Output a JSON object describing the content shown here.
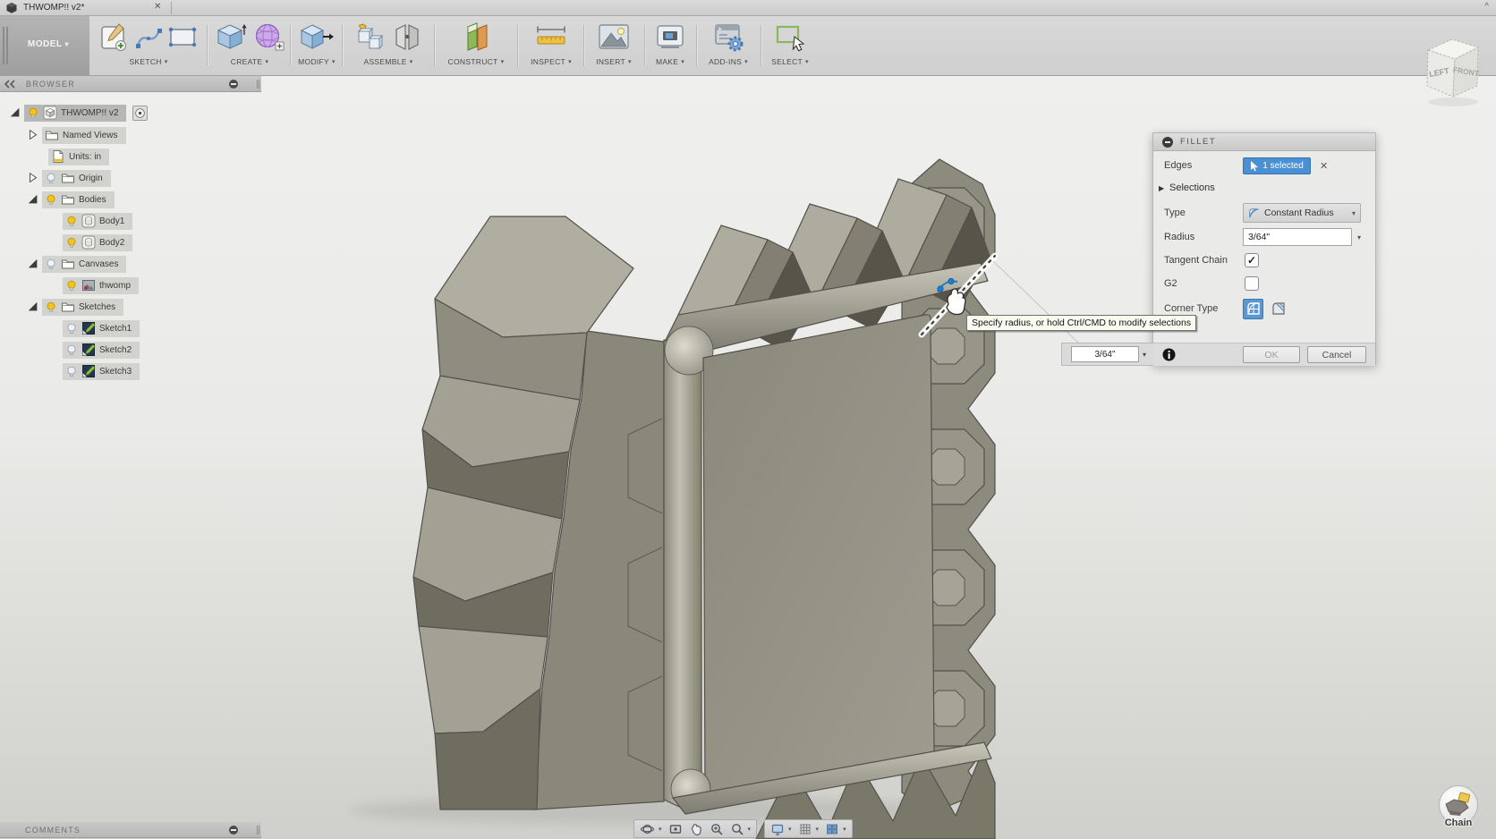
{
  "window": {
    "tab_title": "THWOMP!! v2*",
    "close_glyph": "✕",
    "collapse_caret": "^"
  },
  "toolbar": {
    "workspace_label": "MODEL",
    "caret": "▾",
    "groups": [
      {
        "label": "SKETCH",
        "icons": [
          "create-sketch-icon",
          "spline-icon",
          "sketch-rectangle-icon"
        ]
      },
      {
        "label": "CREATE",
        "icons": [
          "new-body-box-icon",
          "form-sphere-icon"
        ]
      },
      {
        "label": "MODIFY",
        "icons": [
          "press-pull-icon"
        ]
      },
      {
        "label": "ASSEMBLE",
        "icons": [
          "new-component-icon",
          "joint-icon"
        ]
      },
      {
        "label": "CONSTRUCT",
        "icons": [
          "construction-plane-icon"
        ]
      },
      {
        "label": "INSPECT",
        "icons": [
          "measure-icon"
        ]
      },
      {
        "label": "INSERT",
        "icons": [
          "insert-image-icon"
        ]
      },
      {
        "label": "MAKE",
        "icons": [
          "3d-print-icon"
        ]
      },
      {
        "label": "ADD-INS",
        "icons": [
          "scripts-addins-icon"
        ]
      },
      {
        "label": "SELECT",
        "icons": [
          "select-window-icon"
        ]
      }
    ]
  },
  "browser": {
    "title": "BROWSER",
    "tree": [
      {
        "label": "THWOMP!! v2",
        "selected": true,
        "bulb": "on"
      },
      {
        "label": "Named Views",
        "selected": false,
        "bulb": "none"
      },
      {
        "label": "Units: in",
        "selected": false,
        "bulb": "none"
      },
      {
        "label": "Origin",
        "selected": false,
        "bulb": "off"
      },
      {
        "label": "Bodies",
        "selected": false,
        "bulb": "on"
      },
      {
        "label": "Body1",
        "selected": false,
        "bulb": "on"
      },
      {
        "label": "Body2",
        "selected": false,
        "bulb": "on"
      },
      {
        "label": "Canvases",
        "selected": false,
        "bulb": "off"
      },
      {
        "label": "thwomp",
        "selected": false,
        "bulb": "on"
      },
      {
        "label": "Sketches",
        "selected": false,
        "bulb": "on"
      },
      {
        "label": "Sketch1",
        "selected": false,
        "bulb": "off"
      },
      {
        "label": "Sketch2",
        "selected": false,
        "bulb": "off"
      },
      {
        "label": "Sketch3",
        "selected": false,
        "bulb": "off"
      }
    ]
  },
  "fillet_dialog": {
    "title": "FILLET",
    "edges_label": "Edges",
    "edges_selected_count": "1 selected",
    "clear_glyph": "✕",
    "selections_label": "Selections",
    "selections_tri": "▶",
    "type_label": "Type",
    "type_value": "Constant Radius",
    "radius_label": "Radius",
    "radius_value": "3/64\"",
    "tangent_chain_label": "Tangent Chain",
    "tangent_chain_checked": true,
    "check_glyph": "✓",
    "g2_label": "G2",
    "g2_checked": false,
    "corner_type_label": "Corner Type",
    "ok_label": "OK",
    "cancel_label": "Cancel"
  },
  "canvas": {
    "tooltip": "Specify radius, or hold Ctrl/CMD to modify selections",
    "radius_input_value": "3/64\"",
    "viewcube": {
      "left_label": "LEFT",
      "front_label": "FRONT"
    },
    "watermark_label": "Chain"
  },
  "comments_panel": {
    "title": "COMMENTS"
  },
  "colors": {
    "accent_blue": "#4a90d2",
    "bulb_on": "#f5c41a",
    "model_top_face": "#aeac9f",
    "model_front_face": "#8f8d80",
    "model_dark_face": "#6f6d60",
    "viewport_background": "#e9e9e7"
  }
}
